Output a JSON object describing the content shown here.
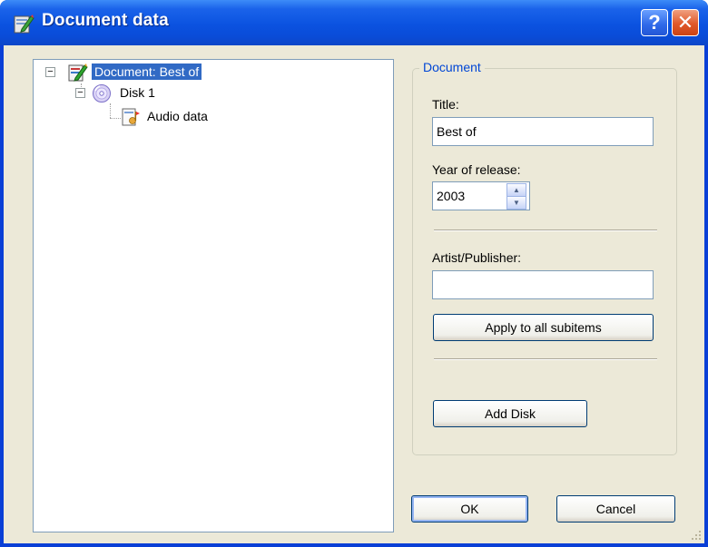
{
  "window": {
    "title": "Document data"
  },
  "titlebar_buttons": {
    "help_label": "?",
    "close_label": "✕"
  },
  "tree": {
    "root": {
      "label": "Document: Best of",
      "expanded": true,
      "selected": true
    },
    "disk": {
      "label": "Disk 1",
      "expanded": true
    },
    "audio": {
      "label": "Audio data"
    },
    "expander_minus": "−"
  },
  "group": {
    "caption": "Document",
    "title_label": "Title:",
    "title_value": "Best of",
    "year_label": "Year of release:",
    "year_value": "2003",
    "spin_up": "▲",
    "spin_down": "▼",
    "artist_label": "Artist/Publisher:",
    "artist_value": "",
    "apply_button": "Apply to all subitems",
    "add_disk_button": "Add Disk"
  },
  "dialog_buttons": {
    "ok": "OK",
    "cancel": "Cancel"
  },
  "colors": {
    "titlebar": "#0a4cd8",
    "selection": "#316ac5",
    "group_caption": "#0046d5",
    "dialog_bg": "#ece9d8"
  }
}
